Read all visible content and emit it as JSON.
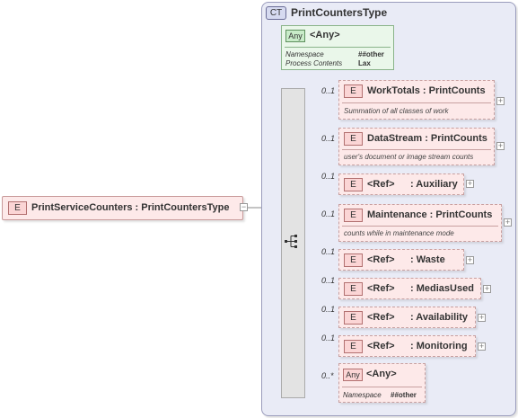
{
  "complex_type": {
    "tag": "CT",
    "name": "PrintCountersType"
  },
  "root_element": {
    "tag": "E",
    "name": "PrintServiceCounters : PrintCountersType"
  },
  "any_attribute": {
    "tag": "Any",
    "name": "<Any>",
    "namespace_label": "Namespace",
    "namespace_value": "##other",
    "process_label": "Process Contents",
    "process_value": "Lax"
  },
  "children": [
    {
      "card": "0..1",
      "tag": "E",
      "name": "WorkTotals : PrintCounts",
      "desc": "Summation of all classes of work"
    },
    {
      "card": "0..1",
      "tag": "E",
      "name": "DataStream : PrintCounts",
      "desc": "user's document or image stream counts"
    },
    {
      "card": "0..1",
      "tag": "E",
      "ref": "<Ref>",
      "name": ": Auxiliary"
    },
    {
      "card": "0..1",
      "tag": "E",
      "name": "Maintenance : PrintCounts",
      "desc": "counts while in maintenance mode"
    },
    {
      "card": "0..1",
      "tag": "E",
      "ref": "<Ref>",
      "name": ": Waste"
    },
    {
      "card": "0..1",
      "tag": "E",
      "ref": "<Ref>",
      "name": ": MediasUsed"
    },
    {
      "card": "0..1",
      "tag": "E",
      "ref": "<Ref>",
      "name": ": Availability"
    },
    {
      "card": "0..1",
      "tag": "E",
      "ref": "<Ref>",
      "name": ": Monitoring"
    }
  ],
  "any_element": {
    "card": "0..*",
    "tag": "Any",
    "name": "<Any>",
    "namespace_label": "Namespace",
    "namespace_value": "##other"
  },
  "toggle_collapse": "−",
  "toggle_expand": "+"
}
